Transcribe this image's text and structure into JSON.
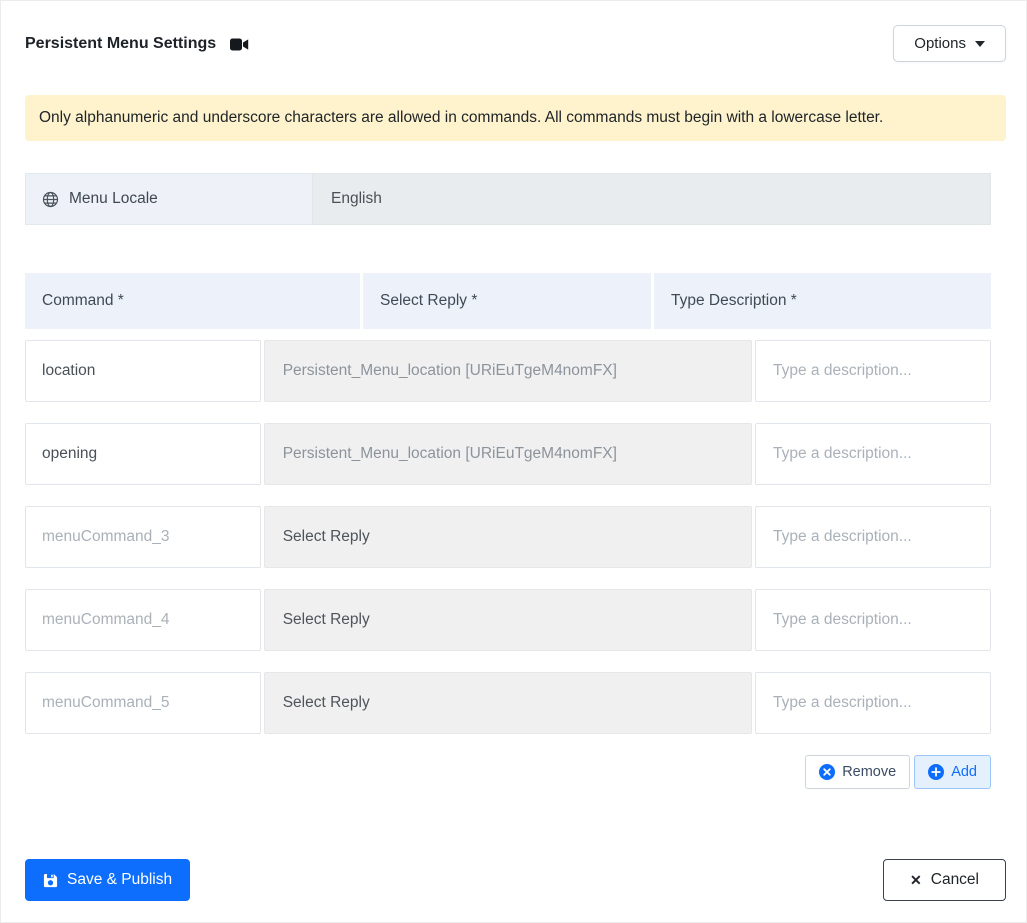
{
  "header": {
    "title": "Persistent Menu Settings",
    "options_button": "Options"
  },
  "alert": {
    "message": "Only alphanumeric and underscore characters are allowed in commands. All commands must begin with a lowercase letter."
  },
  "locale": {
    "label": "Menu Locale",
    "value": "English"
  },
  "commands_table": {
    "headers": {
      "command": "Command *",
      "reply": "Select Reply *",
      "description": "Type Description *"
    },
    "description_placeholder": "Type a description...",
    "rows": [
      {
        "command": "location",
        "command_filled": true,
        "reply": "Persistent_Menu_location [URiEuTgeM4nomFX]",
        "reply_filled": true
      },
      {
        "command": "opening",
        "command_filled": true,
        "reply": "Persistent_Menu_location [URiEuTgeM4nomFX]",
        "reply_filled": true
      },
      {
        "command": "menuCommand_3",
        "command_filled": false,
        "reply": "Select Reply",
        "reply_filled": false
      },
      {
        "command": "menuCommand_4",
        "command_filled": false,
        "reply": "Select Reply",
        "reply_filled": false
      },
      {
        "command": "menuCommand_5",
        "command_filled": false,
        "reply": "Select Reply",
        "reply_filled": false
      }
    ],
    "remove_button": "Remove",
    "add_button": "Add"
  },
  "footer": {
    "save_button": "Save & Publish",
    "cancel_button": "Cancel"
  },
  "colors": {
    "primary": "#0d6efd",
    "alert_bg": "#fff3cd",
    "header_bg": "#edf2fa"
  }
}
